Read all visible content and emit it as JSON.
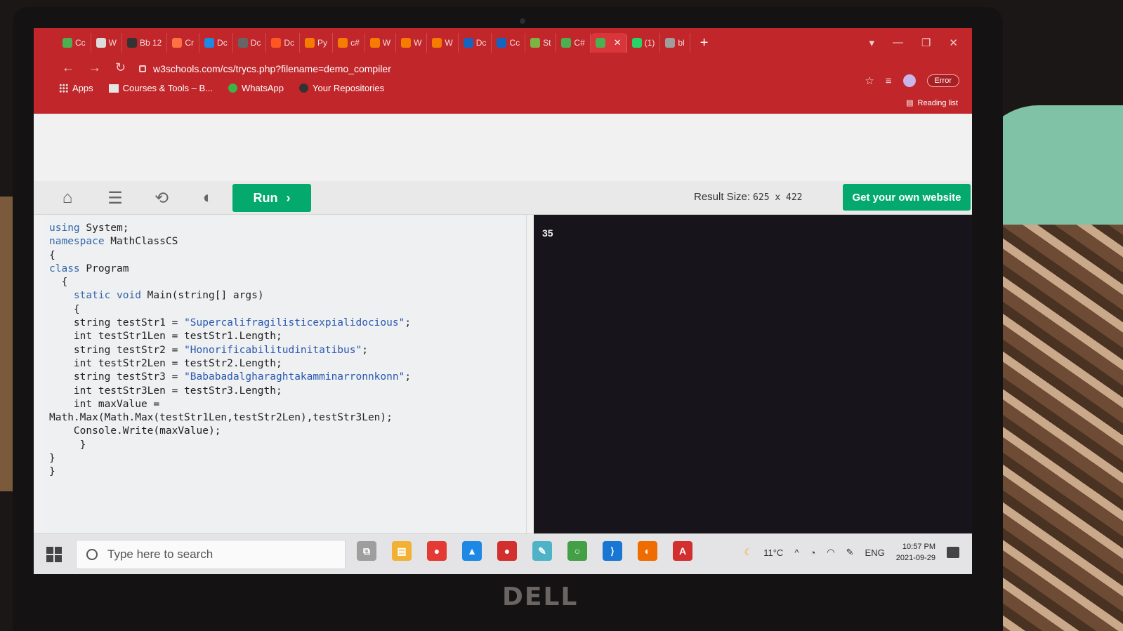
{
  "browser": {
    "tabs": [
      {
        "label": "Cc",
        "color": "#4caf50"
      },
      {
        "label": "W",
        "color": "#dcdcdc"
      },
      {
        "label": "Bb 12",
        "color": "#333333"
      },
      {
        "label": "Cr",
        "color": "#ff7043"
      },
      {
        "label": "Dc",
        "color": "#1e88e5"
      },
      {
        "label": "Dc",
        "color": "#666666"
      },
      {
        "label": "Dc",
        "color": "#ff5722"
      },
      {
        "label": "Py",
        "color": "#f57c00"
      },
      {
        "label": "c#",
        "color": "#f57c00"
      },
      {
        "label": "W",
        "color": "#f57c00"
      },
      {
        "label": "W",
        "color": "#f57c00"
      },
      {
        "label": "W",
        "color": "#f57c00"
      },
      {
        "label": "Dc",
        "color": "#1565c0"
      },
      {
        "label": "Cc",
        "color": "#1565c0"
      },
      {
        "label": "St",
        "color": "#7cb342"
      },
      {
        "label": "C#",
        "color": "#4caf50"
      },
      {
        "label": "",
        "color": "#4caf50",
        "active": true
      },
      {
        "label": "(1)",
        "color": "#25d366"
      },
      {
        "label": "bl",
        "color": "#9e9e9e"
      }
    ],
    "address": "w3schools.com/cs/trycs.php?filename=demo_compiler",
    "error_label": "Error",
    "bookmarks": [
      "Apps",
      "Courses & Tools – B...",
      "WhatsApp",
      "Your Repositories"
    ],
    "reading_list": "Reading list"
  },
  "toolbar": {
    "run_label": "Run",
    "result_size_label": "Result Size:",
    "result_size_value": "625 x 422",
    "cta_label": "Get your own website"
  },
  "editor": {
    "lines": [
      "using System;",
      "namespace MathClassCS",
      "{",
      "class Program",
      "  {",
      "    static void Main(string[] args)",
      "    {",
      "    string testStr1 = \"Supercalifragilisticexpialidocious\";",
      "    int testStr1Len = testStr1.Length;",
      "    string testStr2 = \"Honorificabilitudinitatibus\";",
      "    int testStr2Len = testStr2.Length;",
      "    string testStr3 = \"Bababadalgharaghtakamminarronnkonn\";",
      "    int testStr3Len = testStr3.Length;",
      "    int maxValue =",
      "Math.Max(Math.Max(testStr1Len,testStr2Len),testStr3Len);",
      "    Console.Write(maxValue);",
      "     }",
      "}",
      "}"
    ]
  },
  "output": {
    "text": "35"
  },
  "taskbar": {
    "search_placeholder": "Type here to search",
    "weather": "11°C",
    "language": "ENG",
    "time": "10:57 PM",
    "date": "2021-09-29",
    "apps": [
      {
        "name": "task-view-icon",
        "color": "#9e9e9e",
        "glyph": "⧉"
      },
      {
        "name": "file-explorer-icon",
        "color": "#f2b134",
        "glyph": "▤"
      },
      {
        "name": "chrome-icon",
        "color": "#e53935",
        "glyph": "●"
      },
      {
        "name": "photos-icon",
        "color": "#1e88e5",
        "glyph": "▲"
      },
      {
        "name": "chrome-profile-icon",
        "color": "#d32f2f",
        "glyph": "●"
      },
      {
        "name": "notes-icon",
        "color": "#4fb3c8",
        "glyph": "✎"
      },
      {
        "name": "refresh-app-icon",
        "color": "#43a047",
        "glyph": "○"
      },
      {
        "name": "vscode-icon",
        "color": "#1976d2",
        "glyph": "⟩"
      },
      {
        "name": "app-orange-icon",
        "color": "#ef6c00",
        "glyph": "◐"
      },
      {
        "name": "acrobat-icon",
        "color": "#d32f2f",
        "glyph": "A"
      }
    ]
  }
}
